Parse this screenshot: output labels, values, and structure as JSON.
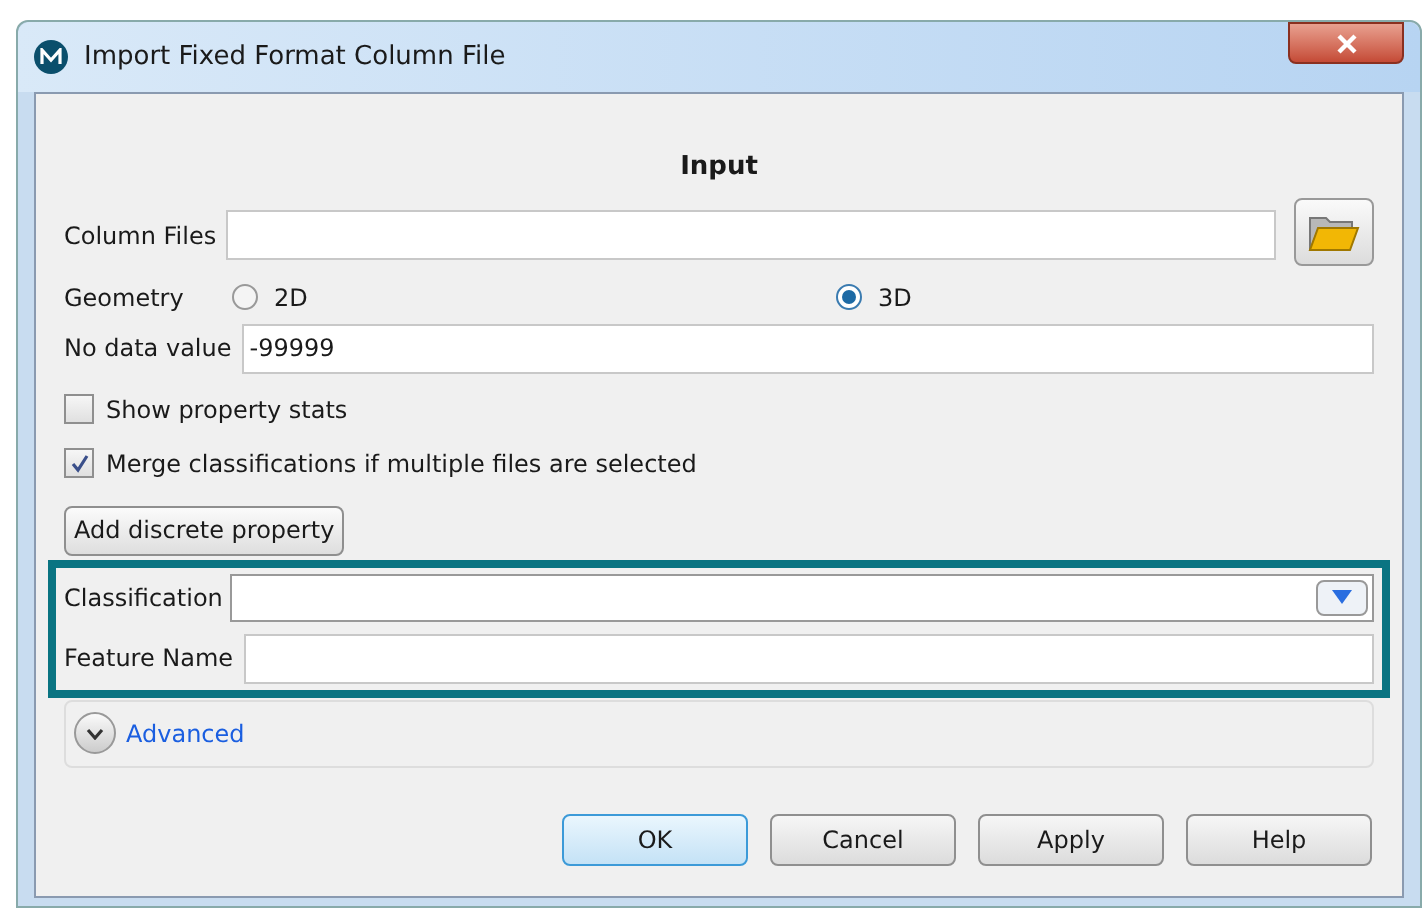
{
  "window": {
    "title": "Import Fixed Format Column File"
  },
  "section_title": "Input",
  "column_files": {
    "label": "Column Files"
  },
  "geometry": {
    "label": "Geometry",
    "options": [
      {
        "label": "2D",
        "selected": false
      },
      {
        "label": "3D",
        "selected": true
      }
    ]
  },
  "no_data_value": {
    "label": "No data value",
    "value": "-99999"
  },
  "checkboxes": [
    {
      "label": "Show property stats",
      "checked": false
    },
    {
      "label": "Merge classifications if multiple files are selected",
      "checked": true
    }
  ],
  "add_button": "Add discrete property",
  "classification": {
    "label": "Classification"
  },
  "feature_name": {
    "label": "Feature Name"
  },
  "advanced": {
    "label": "Advanced",
    "expanded": false
  },
  "buttons": [
    {
      "label": "OK",
      "selected": true
    },
    {
      "label": "Cancel",
      "selected": false
    },
    {
      "label": "Apply",
      "selected": false
    },
    {
      "label": "Help",
      "selected": false
    }
  ]
}
